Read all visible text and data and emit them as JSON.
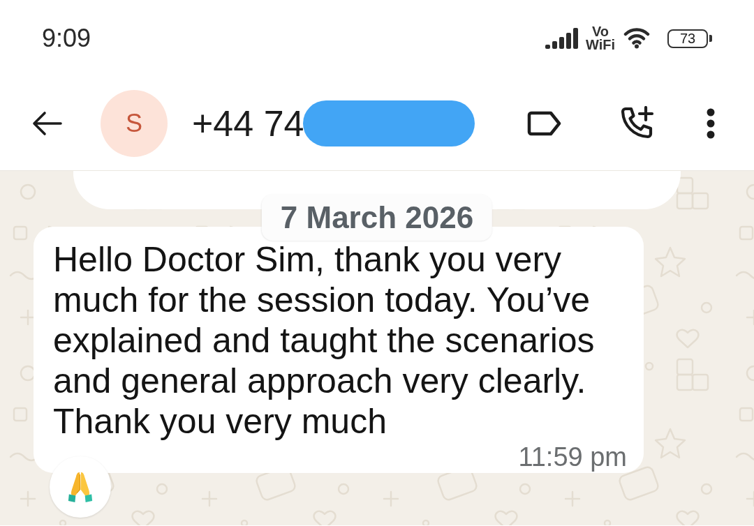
{
  "status_bar": {
    "time": "9:09",
    "network_label": [
      "Vo",
      "WiFi"
    ],
    "battery": "73"
  },
  "header": {
    "avatar_initial": "S",
    "title": "+44 74",
    "title_redacted": true
  },
  "conversation": {
    "date_chip": "7 March 2026",
    "messages": [
      {
        "kind": "clipped"
      },
      {
        "kind": "incoming",
        "text": "Hello Doctor Sim, thank you very much for the session today. You’ve explained and taught the scenarios and general approach very clearly. Thank you very much",
        "time": "11:59 pm",
        "reactions": [
          {
            "kind": "pray"
          }
        ]
      }
    ]
  }
}
